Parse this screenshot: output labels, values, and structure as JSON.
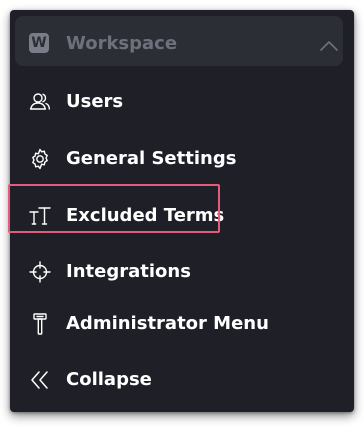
{
  "workspace": {
    "badge": "W",
    "title": "Workspace",
    "icon": "chevron-up-icon"
  },
  "menu": {
    "items": [
      {
        "label": "Users",
        "icon": "users-icon"
      },
      {
        "label": "General Settings",
        "icon": "gear-icon"
      },
      {
        "label": "Excluded Terms",
        "icon": "text-size-icon"
      },
      {
        "label": "Integrations",
        "icon": "crosshair-icon"
      },
      {
        "label": "Administrator Menu",
        "icon": "hammer-icon"
      },
      {
        "label": "Collapse",
        "icon": "double-chevron-left-icon"
      }
    ]
  },
  "colors": {
    "panel_bg": "#1f2027",
    "header_bg": "#2c2e36",
    "highlight": "#e45b7c",
    "text": "#ffffff",
    "muted": "#6e717b"
  }
}
